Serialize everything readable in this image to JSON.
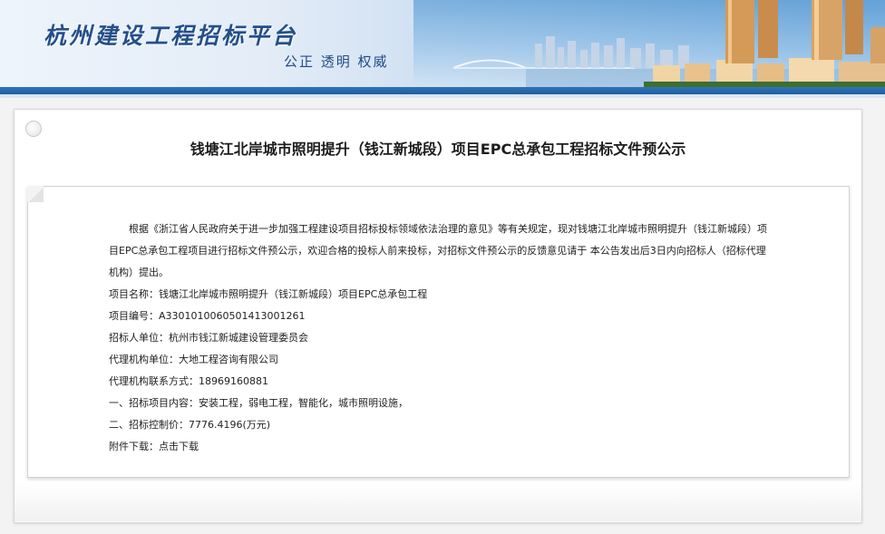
{
  "header": {
    "site_title": "杭州建设工程招标平台",
    "slogan": "公正  透明  权威"
  },
  "notice": {
    "title": "钱塘江北岸城市照明提升（钱江新城段）项目EPC总承包工程招标文件预公示",
    "intro": "根据《浙江省人民政府关于进一步加强工程建设项目招标投标领域依法治理的意见》等有关规定，现对钱塘江北岸城市照明提升（钱江新城段）项目EPC总承包工程项目进行招标文件预公示，欢迎合格的投标人前来投标，对招标文件预公示的反馈意见请于 本公告发出后3日内向招标人（招标代理机构）提出。",
    "project_name": "项目名称：钱塘江北岸城市照明提升（钱江新城段）项目EPC总承包工程",
    "project_code": "项目编号：A3301010060501413001261",
    "tenderer": "招标人单位：杭州市钱江新城建设管理委员会",
    "agency": "代理机构单位：大地工程咨询有限公司",
    "agency_contact": "代理机构联系方式：18969160881",
    "scope": "一、招标项目内容：安装工程，弱电工程，智能化，城市照明设施，",
    "control_price": "二、招标控制价：7776.4196(万元)",
    "attachment_label": "附件下载：",
    "attachment_link": "点击下载"
  }
}
